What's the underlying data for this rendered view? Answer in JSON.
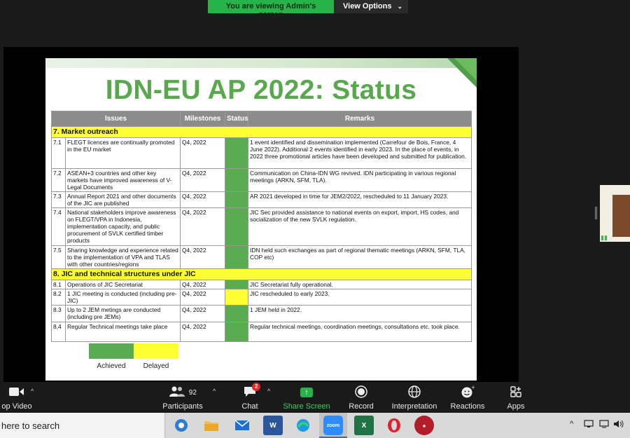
{
  "banner": {
    "viewing_text": "You are viewing Admin's screen",
    "view_options_label": "View Options"
  },
  "slide": {
    "title": "IDN-EU AP 2022: Status",
    "columns": [
      "Issues",
      "Milestones",
      "Status",
      "Remarks"
    ],
    "sections": [
      {
        "title": "7. Market outreach",
        "rows": [
          {
            "no": "7.1",
            "issue": "FLEGT licences are continually promoted in the EU market",
            "milestone": "Q4, 2022",
            "status": "achieved",
            "remarks": "1 event identified and dissemination implemented (Carrefour de Bois, France, 4 June 2022). Additional 2 events identified in early 2023. In the place of events, in 2022 three promotional articles have been developed and submitted for publication."
          },
          {
            "no": "7.2",
            "issue": "ASEAN+3 countries and other key markets have improved awareness of V-Legal Documents",
            "milestone": "Q4, 2022",
            "status": "achieved",
            "remarks": "Communication on China-IDN WG revived. IDN participating in various regional meetings (ARKN, SFM, TLA)."
          },
          {
            "no": "7.3",
            "issue": "Annual Report 2021 and other documents of the JIC are published",
            "milestone": "Q4, 2022",
            "status": "achieved",
            "remarks": "AR 2021 developed in time for JEM2/2022, rescheduled to 11 January 2023."
          },
          {
            "no": "7.4",
            "issue": "National stakeholders improve awareness on FLEGT/VPA in Indonesia, implementation capacity, and public procurement of SVLK certified timber products",
            "milestone": "Q4, 2022",
            "status": "achieved",
            "remarks": "JIC Sec provided assistance to national events on export, import, HS codes, and socialization of the new SVLK regulation."
          },
          {
            "no": "7.5",
            "issue": "Sharing knowledge and experience related to the implementation of VPA and TLAS with other countries/regions",
            "milestone": "Q4, 2022",
            "status": "achieved",
            "remarks": "IDN held such exchanges as part of regional thematic meetings (ARKN, SFM, TLA, COP etc)"
          }
        ]
      },
      {
        "title": "8. JIC and technical structures under JIC",
        "rows": [
          {
            "no": "8.1",
            "issue": "Operations of JIC Secretariat",
            "milestone": "Q4, 2022",
            "status": "achieved",
            "remarks": "JIC Secretariat fully operational."
          },
          {
            "no": "8.2",
            "issue": "1 JIC meeting is conducted (including pre-JIC)",
            "milestone": "Q4, 2022",
            "status": "delayed",
            "remarks": "JIC rescheduled to early 2023."
          },
          {
            "no": "8.3",
            "issue": "Up to 2 JEM metings are conducted (including pre JEMs)",
            "milestone": "Q4, 2022",
            "status": "achieved",
            "remarks": "1 JEM held in 2022."
          },
          {
            "no": "8.4",
            "issue": "Regular Technical meetings take place",
            "milestone": "Q4, 2022",
            "status": "achieved",
            "remarks": "Regular technical meetings, coordination  meetings, consultations etc. took place."
          }
        ]
      }
    ],
    "legend": [
      {
        "label": "Achieved",
        "color": "#5aac52"
      },
      {
        "label": "Delayed",
        "color": "#ffff33"
      }
    ]
  },
  "toolbar": {
    "video_label": "op Video",
    "participants_label": "Participants",
    "participants_count": "92",
    "chat_label": "Chat",
    "chat_badge": "2",
    "share_label": "Share Screen",
    "record_label": "Record",
    "interpretation_label": "Interpretation",
    "reactions_label": "Reactions",
    "apps_label": "Apps"
  },
  "taskbar": {
    "search_text": "here to search",
    "apps": [
      "edge-legacy",
      "file-explorer",
      "mail",
      "word",
      "edge",
      "zoom",
      "excel",
      "opera",
      "game"
    ]
  },
  "colors": {
    "achieved": "#5aac52",
    "delayed": "#ffff33",
    "share_green": "#26b34a",
    "title_green": "#5aa84e"
  }
}
